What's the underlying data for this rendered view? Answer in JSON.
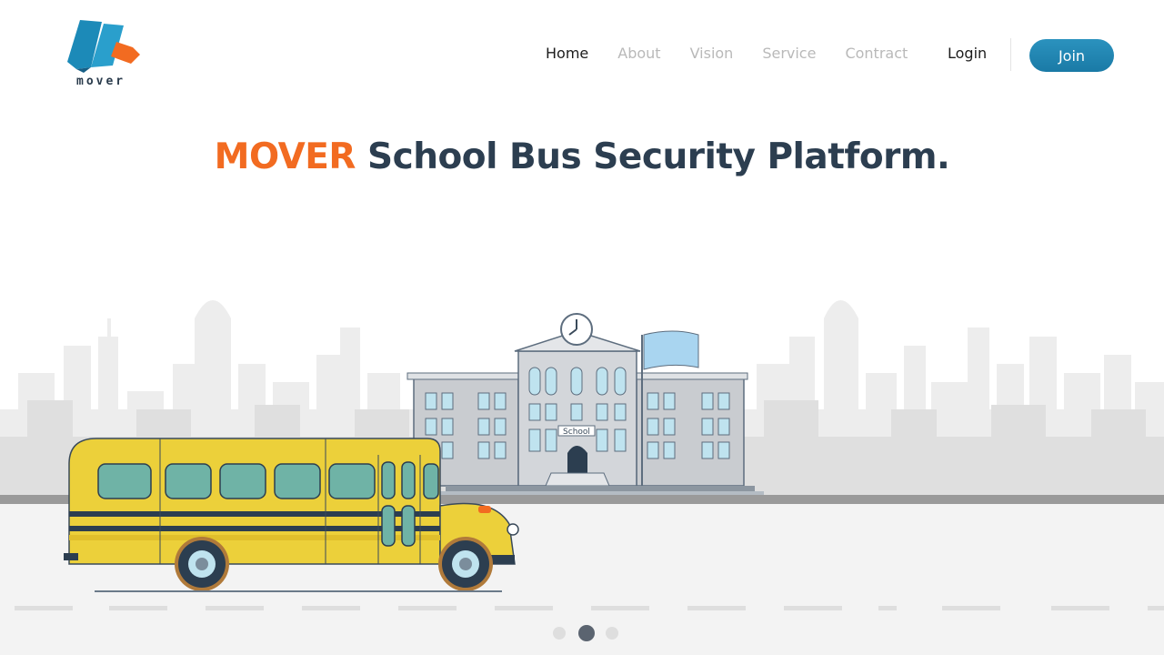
{
  "brand": {
    "logo_icon": "mover-logo-icon",
    "name": "mover",
    "colors": {
      "blue": "#1f86b3",
      "orange": "#f26b21"
    }
  },
  "nav": {
    "items": [
      {
        "label": "Home",
        "active": true
      },
      {
        "label": "About",
        "active": false
      },
      {
        "label": "Vision",
        "active": false
      },
      {
        "label": "Service",
        "active": false
      },
      {
        "label": "Contract",
        "active": false
      }
    ],
    "login_label": "Login",
    "join_label": "Join"
  },
  "hero": {
    "title_brand": "MOVER",
    "title_rest": " School Bus Security Platform.",
    "illustration": {
      "building_sign": "School",
      "icons": [
        "city-skyline-illustration",
        "school-building-illustration",
        "clock-icon",
        "flag-icon",
        "school-bus-illustration"
      ]
    }
  },
  "carousel": {
    "total_slides": 3,
    "active_index": 1
  },
  "colors": {
    "accent": "#f26b21",
    "heading": "#2c3e50",
    "button": "#1f86b3",
    "bus_yellow": "#ecd03a",
    "road": "#f3f3f3",
    "skyline": "#e6e6e6"
  }
}
